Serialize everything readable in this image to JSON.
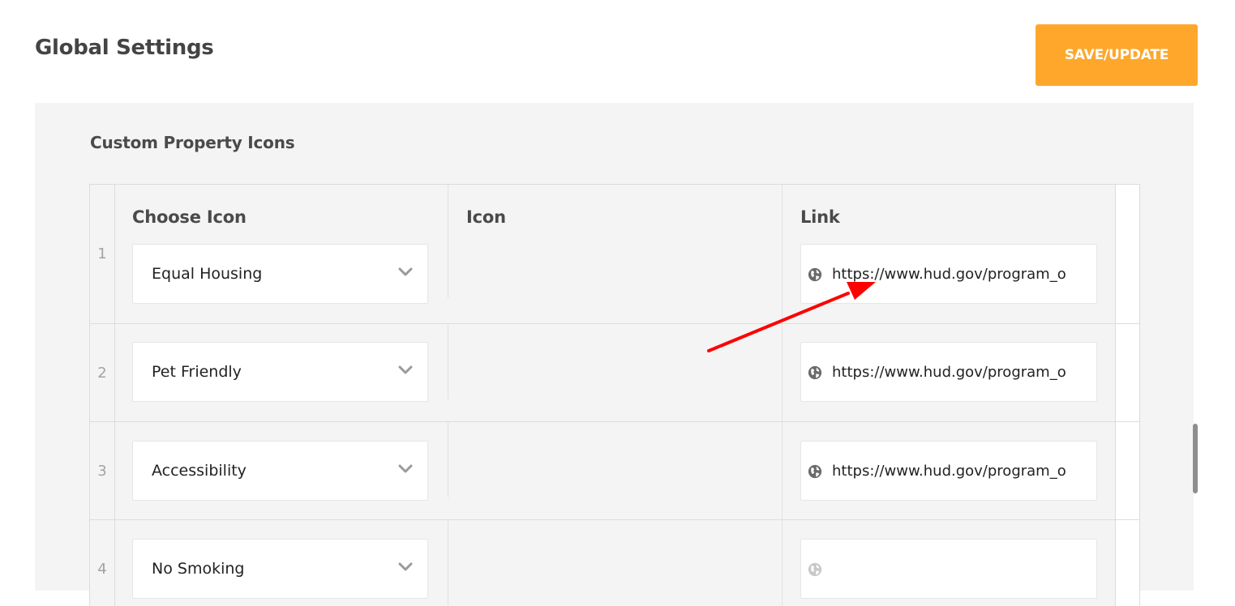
{
  "header": {
    "title": "Global Settings",
    "save_label": "SAVE/UPDATE",
    "accent_color": "#ffa72b"
  },
  "section": {
    "title": "Custom Property Icons"
  },
  "columns": {
    "choose_icon": "Choose Icon",
    "icon": "Icon",
    "link": "Link"
  },
  "rows": [
    {
      "index": "1",
      "icon_choice": "Equal Housing",
      "link": "https://www.hud.gov/program_o"
    },
    {
      "index": "2",
      "icon_choice": "Pet Friendly",
      "link": "https://www.hud.gov/program_o"
    },
    {
      "index": "3",
      "icon_choice": "Accessibility",
      "link": "https://www.hud.gov/program_o"
    },
    {
      "index": "4",
      "icon_choice": "No Smoking",
      "link": ""
    }
  ],
  "icons": {
    "dropdown": "chevron-down-icon",
    "link_prefix": "globe-icon"
  },
  "annotation": {
    "arrow_color": "#ff0000"
  }
}
